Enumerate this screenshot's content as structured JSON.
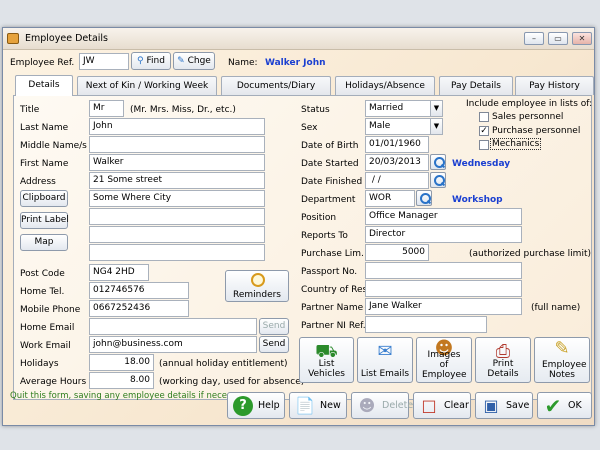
{
  "window": {
    "title": "Employee Details",
    "controls": [
      "–",
      "▭",
      "✕"
    ]
  },
  "header": {
    "employee_ref_label": "Employee Ref.",
    "employee_ref_value": "JW",
    "find_label": "Find",
    "change_label": "Chge",
    "name_label": "Name:",
    "name_value": "Walker  John"
  },
  "tabs": [
    "Details",
    "Next of Kin / Working Week",
    "Documents/Diary",
    "Holidays/Absence",
    "Pay Details",
    "Pay History"
  ],
  "left": {
    "title_label": "Title",
    "title_value": "Mr",
    "title_hint": "(Mr. Mrs. Miss, Dr., etc.)",
    "last_name_label": "Last Name",
    "last_name_value": "John",
    "middle_names_label": "Middle Name/s",
    "middle_names_value": "",
    "first_name_label": "First Name",
    "first_name_value": "Walker",
    "address_label": "Address",
    "address_lines": [
      "21 Some street",
      "Some Where City",
      "",
      "",
      ""
    ],
    "clipboard_label": "Clipboard",
    "print_label_label": "Print Label",
    "map_label": "Map",
    "post_code_label": "Post Code",
    "post_code_value": "NG4 2HD",
    "home_tel_label": "Home Tel.",
    "home_tel_value": "012746576",
    "mobile_label": "Mobile Phone",
    "mobile_value": "0667252436",
    "reminders_label": "Reminders",
    "home_email_label": "Home Email",
    "home_email_value": "",
    "work_email_label": "Work Email",
    "work_email_value": "john@business.com",
    "send_label": "Send",
    "holidays_label": "Holidays",
    "holidays_value": "18.00",
    "holidays_hint": "(annual holiday entitlement)",
    "avg_hours_label": "Average Hours",
    "avg_hours_value": "8.00",
    "avg_hours_hint": "(working day, used for absence)"
  },
  "right": {
    "status_label": "Status",
    "status_value": "Married",
    "sex_label": "Sex",
    "sex_value": "Male",
    "dob_label": "Date of Birth",
    "dob_value": "01/01/1960",
    "started_label": "Date Started",
    "started_value": "20/03/2013",
    "started_day": "Wednesday",
    "finished_label": "Date Finished",
    "finished_value": " / /",
    "department_label": "Department",
    "department_value": "WOR",
    "department_name": "Workshop",
    "position_label": "Position",
    "position_value": "Office Manager",
    "reports_label": "Reports To",
    "reports_value": "Director",
    "purchase_label": "Purchase Lim.",
    "purchase_value": "5000",
    "purchase_hint": "(authorized purchase limit)",
    "passport_label": "Passport No.",
    "passport_value": "",
    "country_label": "Country of Res",
    "country_value": "",
    "partner_label": "Partner Name",
    "partner_value": "Jane Walker",
    "partner_hint": "(full name)",
    "partner_ni_label": "Partner NI Ref.",
    "partner_ni_value": ""
  },
  "lists": {
    "heading": "Include employee in lists of:",
    "items": [
      {
        "label": "Sales personnel",
        "checked": false
      },
      {
        "label": "Purchase personnel",
        "checked": true
      },
      {
        "label": "Mechanics",
        "checked": false
      }
    ]
  },
  "action_buttons": [
    "List Vehicles",
    "List Emails",
    "Images of Employee",
    "Print Details",
    "Employee Notes"
  ],
  "footer": {
    "hint": "Quit this form, saving any employee details if necessary.",
    "help": "Help",
    "new": "New",
    "delete": "Delete",
    "clear": "Clear",
    "save": "Save",
    "ok": "OK"
  },
  "colors": {
    "accent_blue": "#1a3fd1",
    "hint_green": "#2e7d1e",
    "ok_green": "#2c9a2c"
  }
}
